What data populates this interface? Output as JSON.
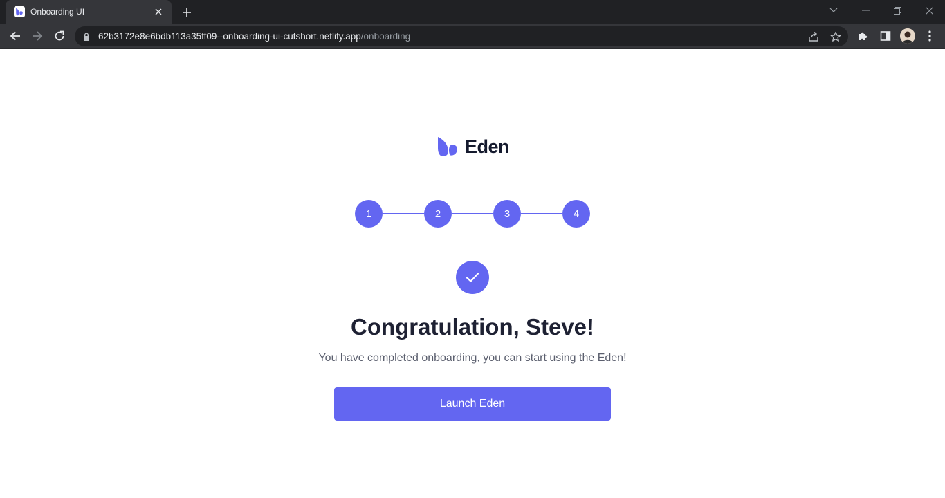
{
  "browser": {
    "tab": {
      "title": "Onboarding UI"
    },
    "url": {
      "host": "62b3172e8e6bdb113a35ff09--onboarding-ui-cutshort.netlify.app",
      "path": "/onboarding"
    },
    "icons": {
      "favicon": "eden-logo-icon",
      "close": "close-icon",
      "new_tab": "plus-icon",
      "back": "arrow-left-icon",
      "forward": "arrow-right-icon",
      "reload": "reload-icon",
      "lock": "lock-icon",
      "share": "share-icon",
      "bookmark": "star-icon",
      "extensions": "puzzle-icon",
      "side_panel": "side-panel-icon",
      "menu": "kebab-menu-icon"
    }
  },
  "app": {
    "logo_text": "Eden",
    "steps": [
      {
        "label": "1"
      },
      {
        "label": "2"
      },
      {
        "label": "3"
      },
      {
        "label": "4"
      }
    ],
    "heading": "Congratulation, Steve!",
    "subtext": "You have completed onboarding, you can start using the Eden!",
    "launch_button": "Launch Eden",
    "colors": {
      "accent": "#6366f1",
      "heading": "#1e2133",
      "subtext": "#5b5f6e"
    }
  }
}
